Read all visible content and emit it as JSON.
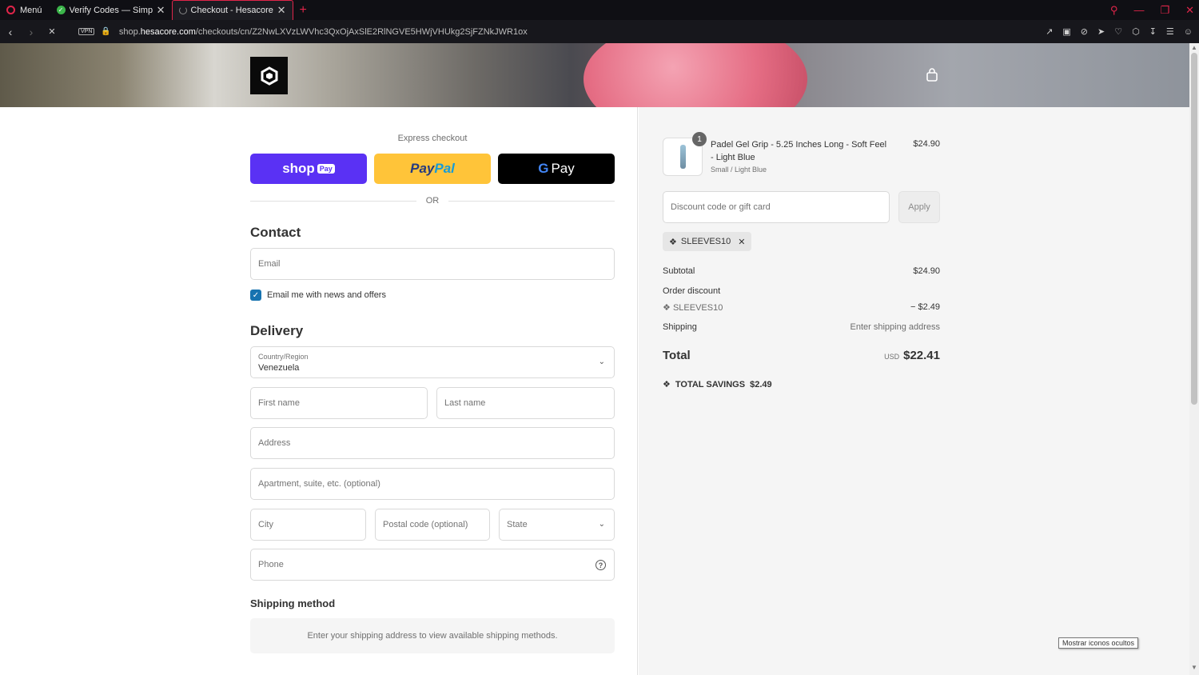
{
  "browser": {
    "menu_label": "Menú",
    "tabs": [
      {
        "title": "Verify Codes — SimplyCod"
      },
      {
        "title": "Checkout - Hesacore Grip"
      }
    ],
    "new_tab": "+",
    "vpn": "VPN",
    "url_host": "shop.hesacore.com",
    "url_prefix": "shop.",
    "url_domain": "hesacore.com",
    "url_path": "/checkouts/cn/Z2NwLXVzLWVhc3QxOjAxSlE2RlNGVE5HWjVHUkg2SjFZNkJWR1ox"
  },
  "checkout": {
    "express_label": "Express checkout",
    "shop_pay": {
      "brand": "shop",
      "pill": "Pay"
    },
    "paypal": {
      "part1": "Pay",
      "part2": "Pal"
    },
    "gpay": {
      "g": "G",
      "label": "Pay"
    },
    "or_label": "OR",
    "contact_heading": "Contact",
    "email_placeholder": "Email",
    "newsletter_label": "Email me with news and offers",
    "delivery_heading": "Delivery",
    "country_label": "Country/Region",
    "country_value": "Venezuela",
    "first_name_placeholder": "First name",
    "last_name_placeholder": "Last name",
    "address_placeholder": "Address",
    "apartment_placeholder": "Apartment, suite, etc. (optional)",
    "city_placeholder": "City",
    "postal_placeholder": "Postal code (optional)",
    "state_placeholder": "State",
    "phone_placeholder": "Phone",
    "shipping_method_heading": "Shipping method",
    "shipping_method_notice": "Enter your shipping address to view available shipping methods."
  },
  "summary": {
    "product": {
      "quantity": "1",
      "name": "Padel Gel Grip - 5.25 Inches Long - Soft Feel - Light Blue",
      "variant": "Small / Light Blue",
      "price": "$24.90"
    },
    "discount_placeholder": "Discount code or gift card",
    "apply_label": "Apply",
    "applied_code": "SLEEVES10",
    "subtotal_label": "Subtotal",
    "subtotal_value": "$24.90",
    "order_discount_label": "Order discount",
    "discount_code": "SLEEVES10",
    "discount_value": "− $2.49",
    "shipping_label": "Shipping",
    "shipping_value": "Enter shipping address",
    "total_label": "Total",
    "currency": "USD",
    "total_value": "$22.41",
    "savings_label": "TOTAL SAVINGS",
    "savings_value": "$2.49"
  },
  "tooltip": "Mostrar iconos ocultos",
  "colors": {
    "accent": "#1773b0",
    "shop_pay": "#5a31f4",
    "paypal": "#ffc439",
    "opera_red": "#e0254a"
  }
}
